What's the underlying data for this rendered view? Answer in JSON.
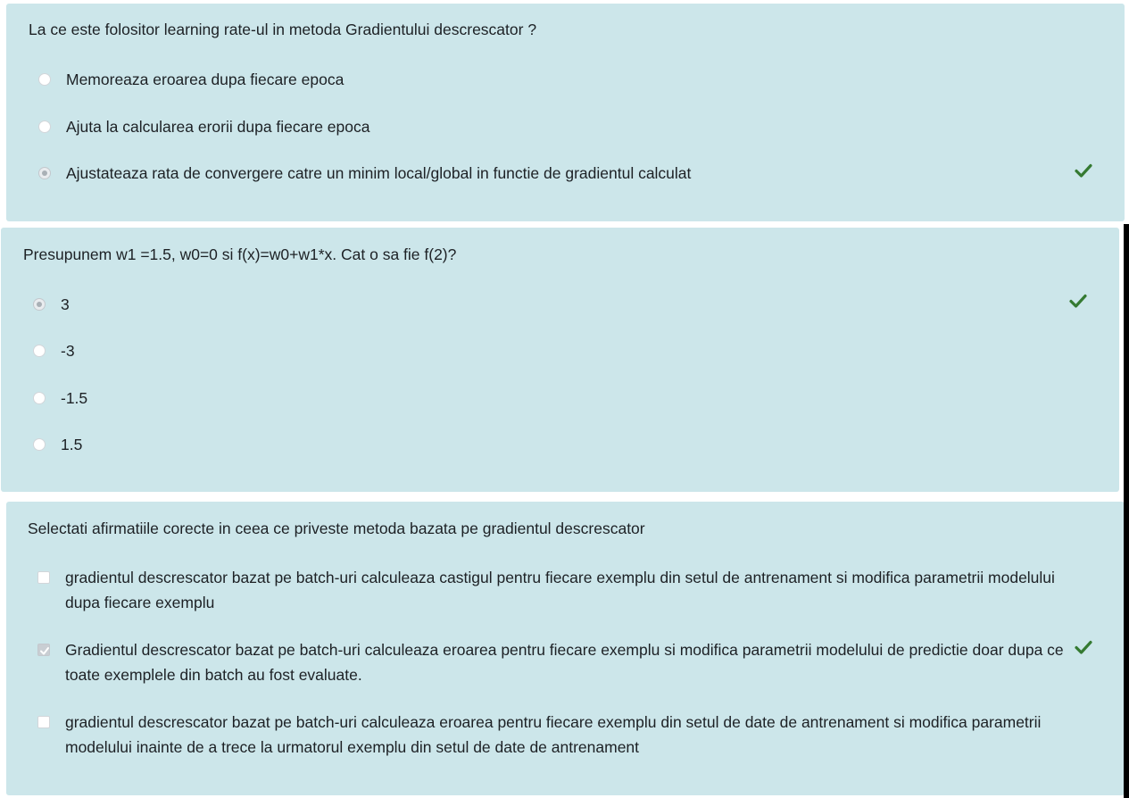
{
  "questions": [
    {
      "text": "La ce este folositor learning rate-ul in metoda Gradientului descrescator ?",
      "options": [
        {
          "label": "Memoreaza eroarea dupa fiecare epoca",
          "selected": false
        },
        {
          "label": "Ajuta la calcularea erorii dupa fiecare epoca",
          "selected": false
        },
        {
          "label": "Ajustateaza rata de convergere catre un minim local/global in functie de gradientul calculat",
          "selected": true,
          "correct": true
        }
      ]
    },
    {
      "text": "Presupunem w1 =1.5, w0=0 si f(x)=w0+w1*x. Cat o sa fie f(2)?",
      "options": [
        {
          "label": "3",
          "selected": true,
          "correct": true
        },
        {
          "label": "-3",
          "selected": false
        },
        {
          "label": "-1.5",
          "selected": false
        },
        {
          "label": "1.5",
          "selected": false
        }
      ]
    },
    {
      "text": "Selectati afirmatiile corecte in ceea ce priveste metoda bazata pe gradientul descrescator",
      "options": [
        {
          "label": "gradientul descrescator bazat pe batch-uri calculeaza castigul pentru fiecare exemplu din setul de antrenament si modifica parametrii modelului dupa fiecare exemplu",
          "selected": false
        },
        {
          "label": "Gradientul descrescator bazat pe batch-uri calculeaza eroarea pentru fiecare exemplu si modifica parametrii modelului de predictie doar dupa ce toate exemplele din batch au fost evaluate.",
          "selected": true,
          "correct": true
        },
        {
          "label": "gradientul descrescator bazat pe batch-uri calculeaza eroarea pentru fiecare exemplu din setul de date de antrenament si modifica parametrii modelului inainte de a trece la urmatorul exemplu din setul de date de antrenament",
          "selected": false
        }
      ]
    }
  ],
  "colors": {
    "card_bg": "#cce6ea",
    "correct_check": "#357a32",
    "text": "#1d2125"
  },
  "icons": {
    "correct": "check-icon"
  }
}
